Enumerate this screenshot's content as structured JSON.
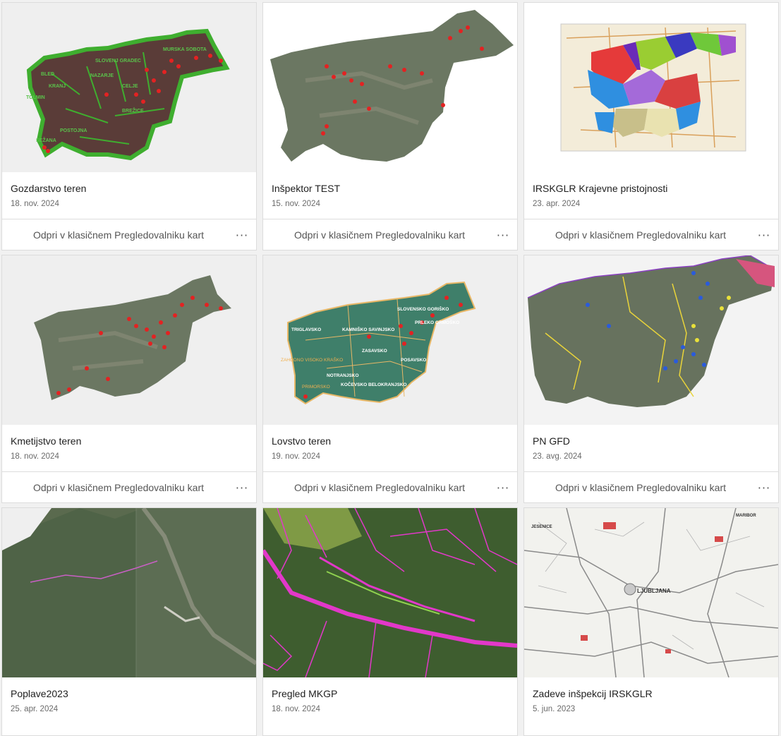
{
  "cards": [
    {
      "title": "Gozdarstvo teren",
      "date": "18. nov. 2024",
      "action": "Odpri v klasičnem Pregledovalniku kart",
      "more": "···",
      "thumb": "forest-districts-map"
    },
    {
      "title": "Inšpektor TEST",
      "date": "15. nov. 2024",
      "action": "Odpri v klasičnem Pregledovalniku kart",
      "more": "···",
      "thumb": "satellite-map-points"
    },
    {
      "title": "IRSKGLR Krajevne pristojnosti",
      "date": "23. apr. 2024",
      "action": "Odpri v klasičnem Pregledovalniku kart",
      "more": "···",
      "thumb": "jurisdiction-map"
    },
    {
      "title": "Kmetijstvo teren",
      "date": "18. nov. 2024",
      "action": "Odpri v klasičnem Pregledovalniku kart",
      "more": "···",
      "thumb": "satellite-map-points"
    },
    {
      "title": "Lovstvo teren",
      "date": "19. nov. 2024",
      "action": "Odpri v klasičnem Pregledovalniku kart",
      "more": "···",
      "thumb": "hunting-regions-map"
    },
    {
      "title": "PN GFD",
      "date": "23. avg. 2024",
      "action": "Odpri v klasičnem Pregledovalniku kart",
      "more": "···",
      "thumb": "satellite-map-zones"
    },
    {
      "title": "Poplave2023",
      "date": "25. apr. 2024",
      "thumb": "aerial-imagery"
    },
    {
      "title": "Pregled MKGP",
      "date": "18. nov. 2024",
      "thumb": "aerial-parcels"
    },
    {
      "title": "Zadeve inšpekcij IRSKGLR",
      "date": "5. jun. 2023",
      "thumb": "road-map"
    }
  ],
  "map_labels": {
    "forest": [
      "SLOVENJ GRADEC",
      "MURSKA SOBOTA",
      "BLED",
      "NAZARJE",
      "KRANJ",
      "CELJE",
      "TOLMIN",
      "BREŽICE",
      "POSTOJNA",
      "SEŽANA"
    ],
    "hunting": [
      "SLOVENSKO GORIŠKO",
      "TRIGLAVSKO",
      "KAMNIŠKO SAVINJSKO",
      "PRLEKO ORMOŠKO",
      "ZASAVSKO",
      "POSAVSKO",
      "ZAHODNO VISOKO KRAŠKO",
      "NOTRANJSKO",
      "KOČEVSKO BELOKRANJSKO",
      "PRIMORSKO"
    ],
    "road": [
      "LJUBLJANA",
      "MARIBOR",
      "JESENICE"
    ]
  }
}
